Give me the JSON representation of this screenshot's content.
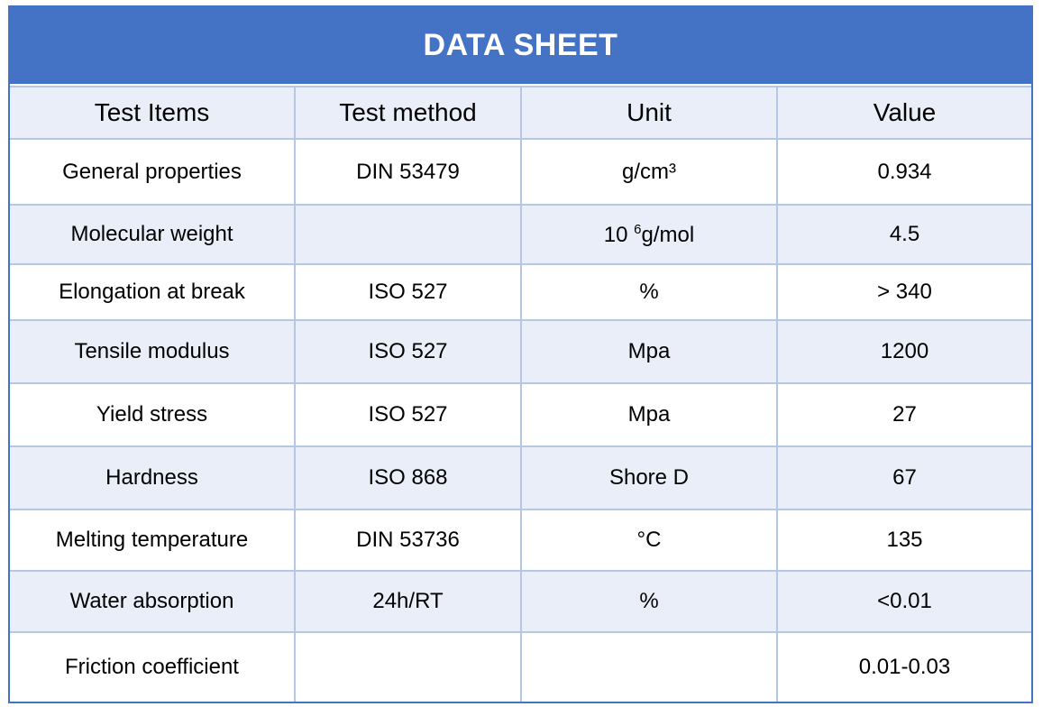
{
  "title": "DATA SHEET",
  "columns": [
    "Test Items",
    "Test method",
    "Unit",
    "Value"
  ],
  "rows": [
    {
      "item": "General properties",
      "method": "DIN 53479",
      "unit": "g/cm³",
      "value": "0.934"
    },
    {
      "item": "Molecular weight",
      "method": "",
      "unit_prefix": "10 ",
      "unit_sup": "6",
      "unit_suffix": "g/mol",
      "value": "4.5"
    },
    {
      "item": "Elongation at break",
      "method": "ISO 527",
      "unit": "%",
      "value": "> 340"
    },
    {
      "item": "Tensile modulus",
      "method": "ISO 527",
      "unit": "Mpa",
      "value": "1200"
    },
    {
      "item": "Yield stress",
      "method": "ISO 527",
      "unit": "Mpa",
      "value": "27"
    },
    {
      "item": "Hardness",
      "method": "ISO 868",
      "unit": "Shore D",
      "value": "67"
    },
    {
      "item": "Melting temperature",
      "method": "DIN 53736",
      "unit": "°C",
      "value": "135"
    },
    {
      "item": "Water absorption",
      "method": "24h/RT",
      "unit": "%",
      "value": "<0.01"
    },
    {
      "item": "Friction coefficient",
      "method": "",
      "unit": "",
      "value": "0.01-0.03"
    }
  ],
  "colors": {
    "header": "#4472c4",
    "row_alt": "#e9eef8",
    "grid": "#b4c7e7"
  }
}
